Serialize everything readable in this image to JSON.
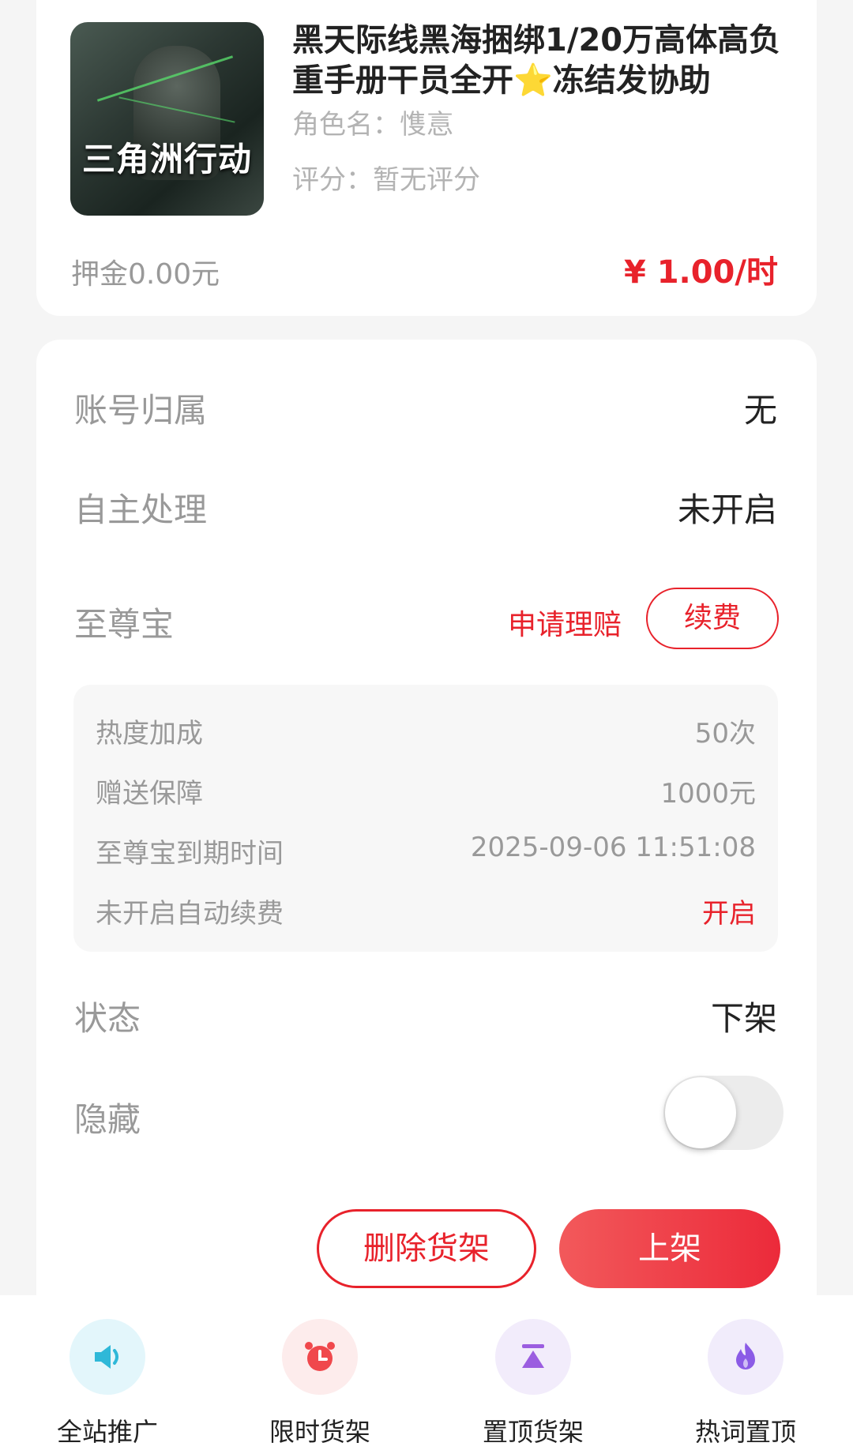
{
  "product": {
    "title": "黑天际线黑海捆绑1/20万高体高负重手册干员全开⭐冻结发协助",
    "thumbnail_text": "三角洲行动",
    "role_name": "角色名：愯悥",
    "rating": "评分：暂无评分",
    "deposit": "押金0.00元",
    "price": "¥ 1.00/时"
  },
  "details": {
    "account_owner": {
      "label": "账号归属",
      "value": "无"
    },
    "self_handling": {
      "label": "自主处理",
      "value": "未开启"
    },
    "supreme": {
      "label": "至尊宝",
      "claim_label": "申请理赔",
      "renew_label": "续费",
      "items": [
        {
          "label": "热度加成",
          "value": "50次"
        },
        {
          "label": "赠送保障",
          "value": "1000元"
        },
        {
          "label": "至尊宝到期时间",
          "value": "2025-09-06 11:51:08"
        },
        {
          "label": "未开启自动续费",
          "value": "开启"
        }
      ]
    },
    "status": {
      "label": "状态",
      "value": "下架"
    },
    "hidden": {
      "label": "隐藏",
      "on": false
    }
  },
  "actions": {
    "delete_label": "删除货架",
    "list_label": "上架"
  },
  "tabbar": [
    {
      "label": "全站推广",
      "icon": "speaker-icon",
      "bg": "#e3f6fb",
      "color": "#2fb8d8"
    },
    {
      "label": "限时货架",
      "icon": "alarm-clock-icon",
      "bg": "#fdecec",
      "color": "#f0484c"
    },
    {
      "label": "置顶货架",
      "icon": "pin-top-icon",
      "bg": "#f2ecfb",
      "color": "#9b5de0"
    },
    {
      "label": "热词置顶",
      "icon": "flame-icon",
      "bg": "#f1ecfb",
      "color": "#8b5be6"
    }
  ],
  "colors": {
    "accent": "#e8222b"
  }
}
